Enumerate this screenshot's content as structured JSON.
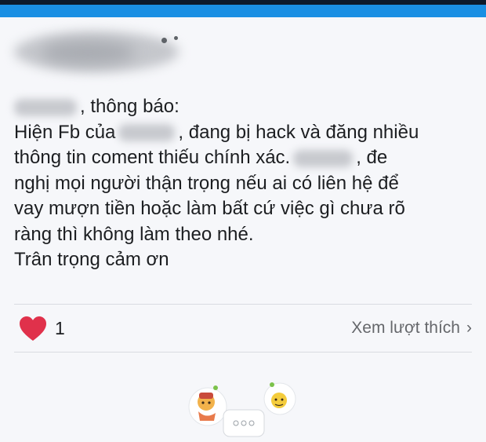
{
  "post": {
    "line1_suffix": ", thông báo:",
    "line2_prefix": "Hiện Fb của",
    "line2_suffix": ", đang bị hack và đăng nhiều",
    "line3_prefix": "thông tin coment thiếu chính xác.",
    "line3_suffix": ", đe",
    "line4": "nghị mọi người thận trọng nếu ai có liên hệ để",
    "line5": "vay mượn tiền hoặc làm bất cứ việc gì chưa rõ",
    "line6": "ràng thì không làm theo nhé.",
    "line7": "Trân trọng cảm ơn"
  },
  "reactions": {
    "icon": "heart-icon",
    "count": "1",
    "see_likes_label": "Xem lượt thích",
    "chevron": "›"
  },
  "colors": {
    "topbar_blue": "#1a8fe3",
    "heart_red": "#e0314b",
    "text": "#1c1e21",
    "secondary_text": "#65676b"
  }
}
